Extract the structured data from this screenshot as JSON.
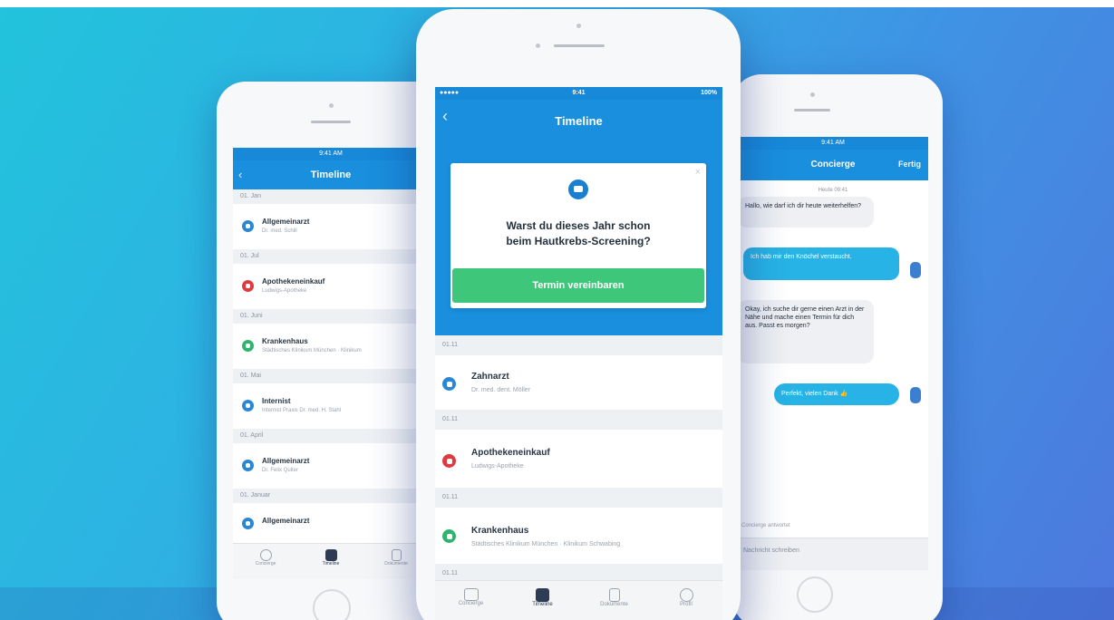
{
  "colors": {
    "accent": "#1a8fdd",
    "cta": "#3ec77a",
    "danger": "#e0393e",
    "success": "#2fb46e",
    "bg_start": "#22c3dc",
    "bg_end": "#4d78dd"
  },
  "left_phone": {
    "status": {
      "time": "9:41 AM"
    },
    "nav": {
      "title": "Timeline"
    },
    "sections": [
      "01. Jan",
      "01. Jul",
      "01. Juni",
      "01. Mai",
      "01. April",
      "01. Januar"
    ],
    "rows": [
      {
        "title": "Allgemeinarzt",
        "subtitle": "Dr. med. Schill",
        "icon": "plus-icon"
      },
      {
        "title": "Apothekeneinkauf",
        "subtitle": "Ludwigs-Apotheke",
        "icon": "cross-icon"
      },
      {
        "title": "Krankenhaus",
        "subtitle": "Städtisches Klinikum München · Klinikum",
        "icon": "hospital-icon"
      },
      {
        "title": "Internist",
        "subtitle": "Internist Praxis Dr. med. H. Stahl",
        "icon": "plus-icon"
      },
      {
        "title": "Allgemeinarzt",
        "subtitle": "Dr. Felix Quiter",
        "icon": "plus-icon"
      },
      {
        "title": "Allgemeinarzt",
        "subtitle": "",
        "icon": "plus-icon"
      }
    ],
    "tabs": [
      {
        "label": "Concierge",
        "icon": "concierge-icon"
      },
      {
        "label": "Timeline",
        "icon": "timeline-icon"
      },
      {
        "label": "Dokumente",
        "icon": "document-icon"
      }
    ]
  },
  "center_phone": {
    "status": {
      "carrier": "●●●●● ",
      "time": "9:41",
      "battery": "100%"
    },
    "nav": {
      "back": "‹",
      "title": "Timeline"
    },
    "card": {
      "question_line1": "Warst du dieses Jahr schon",
      "question_line2": "beim Hautkrebs-Screening?",
      "button": "Termin vereinbaren",
      "close": "×",
      "icon": "doctor-bag-icon"
    },
    "sections": [
      "01.11",
      "01.11",
      "01.11",
      "01.11"
    ],
    "rows": [
      {
        "title": "Zahnarzt",
        "subtitle": "Dr. med. dent. Möller",
        "icon": "plus-icon"
      },
      {
        "title": "Apothekeneinkauf",
        "subtitle": "Ludwigs-Apotheke",
        "icon": "cross-icon"
      },
      {
        "title": "Krankenhaus",
        "subtitle": "Städtisches Klinikum München · Klinikum Schwabing",
        "icon": "hospital-icon"
      }
    ],
    "tabs": [
      {
        "label": "Concierge",
        "icon": "concierge-icon"
      },
      {
        "label": "Timeline",
        "icon": "timeline-icon"
      },
      {
        "label": "Dokumente",
        "icon": "document-icon"
      },
      {
        "label": "Profil",
        "icon": "profile-icon"
      }
    ]
  },
  "right_phone": {
    "status": {
      "time": "9:41 AM"
    },
    "nav": {
      "title": "Concierge",
      "action": "Fertig"
    },
    "date_label": "Heute 09:41",
    "messages": [
      {
        "side": "in",
        "text": "Hallo, wie darf ich dir heute weiterhelfen?"
      },
      {
        "side": "out",
        "text": "Ich hab mir den Knöchel verstaucht."
      },
      {
        "side": "in",
        "text": "Okay, ich suche dir gerne einen Arzt in der Nähe und mache einen Termin für dich aus. Passt es morgen?"
      },
      {
        "side": "out",
        "text": "Perfekt, vielen Dank 👍"
      }
    ],
    "typing_note": "Concierge antwortet",
    "input_placeholder": "Nachricht schreiben"
  }
}
